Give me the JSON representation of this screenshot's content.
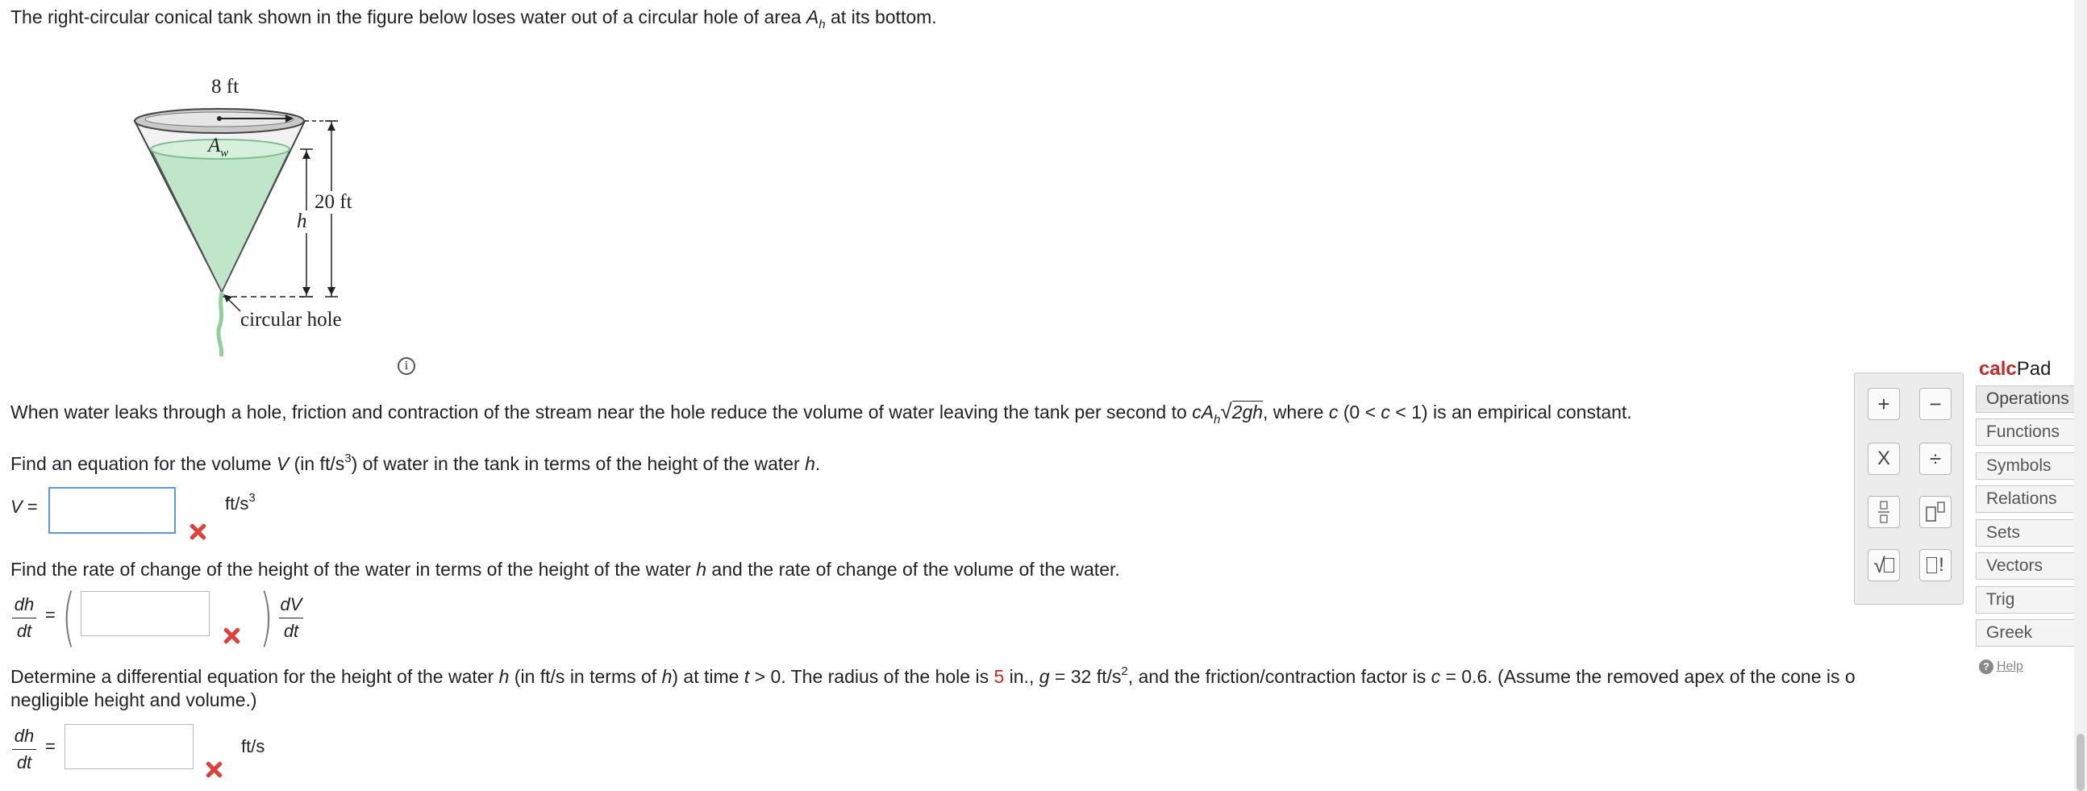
{
  "intro": {
    "text_before": "The right-circular conical tank shown in the figure below loses water out of a circular hole of area ",
    "area_symbol": "A",
    "area_sub": "h",
    "text_after": " at its bottom."
  },
  "figure": {
    "top_dimension": "8 ft",
    "water_area_symbol": "A",
    "water_area_sub": "w",
    "height_dimension": "20 ft",
    "water_height_symbol": "h",
    "hole_label": "circular hole",
    "info_icon": "i"
  },
  "leak_paragraph": {
    "part1": "When water leaks through a hole, friction and contraction of the stream near the hole reduce the volume of water leaving the tank per second to ",
    "c": "c",
    "A": "A",
    "A_sub": "h",
    "sqrt_content": "2gh",
    "part2": ", where ",
    "c2": "c",
    "part3": " (0 < ",
    "c3": "c",
    "part4": " < 1) is an empirical constant."
  },
  "q1": {
    "prompt_before": "Find an equation for the volume ",
    "V": "V",
    "prompt_mid": " (in ft/s",
    "exp": "3",
    "prompt_mid2": ") of water in the tank in terms of the height of the water ",
    "h": "h",
    "prompt_end": ".",
    "lhs": "V",
    "eq": " =",
    "answer_value": "",
    "unit_base": "ft/s",
    "unit_exp": "3"
  },
  "q2": {
    "prompt_before": "Find the rate of change of the height of the water in terms of the height of the water ",
    "h": "h",
    "prompt_after": " and the rate of change of the volume of the water.",
    "lhs_num": "dh",
    "lhs_den": "dt",
    "eq": "=",
    "answer_value": "",
    "rhs_num": "dV",
    "rhs_den": "dt"
  },
  "q3": {
    "p1": "Determine a differential equation for the height of the water ",
    "h": "h",
    "p2": " (in ft/s in terms of ",
    "h2": "h",
    "p3": ") at time ",
    "t": "t",
    "p4": " > 0. The radius of the hole is ",
    "radius": "5",
    "p5": " in., ",
    "g": "g",
    "p6": " = 32 ft/s",
    "g_exp": "2",
    "p7": ", and the friction/contraction factor is ",
    "c": "c",
    "p8": " = 0.6. (Assume the removed apex of the cone is o",
    "line2": "negligible height and volume.)",
    "lhs_num": "dh",
    "lhs_den": "dt",
    "eq": "=",
    "answer_value": "",
    "unit": "ft/s"
  },
  "keypad": {
    "keys": [
      "+",
      "−",
      "X",
      "÷",
      "fraction-icon",
      "exponent-icon",
      "sqrt-icon",
      "factorial-icon"
    ],
    "plus": "+",
    "minus": "−",
    "times": "X",
    "divide": "÷",
    "sqrt_symbol": "√",
    "factorial_symbol": "!"
  },
  "calcpad": {
    "title_part1": "calc",
    "title_part2": "Pad",
    "categories": [
      "Operations",
      "Functions",
      "Symbols",
      "Relations",
      "Sets",
      "Vectors",
      "Trig",
      "Greek"
    ],
    "help_label": "Help",
    "help_icon_glyph": "?"
  },
  "colors": {
    "accent_red": "#cc2a1f",
    "wrong_mark": "#e0403a",
    "active_input_border": "#5b9bd5",
    "water": "#bfe6c8"
  }
}
